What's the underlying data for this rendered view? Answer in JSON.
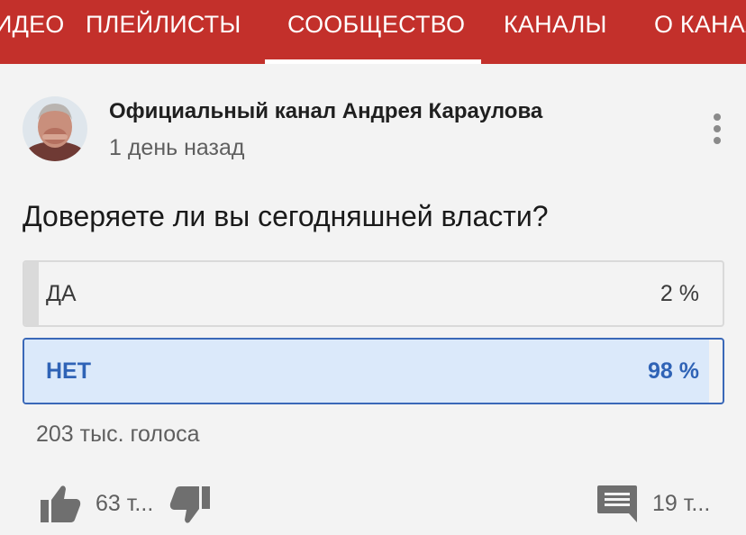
{
  "tabs": [
    {
      "label": "ИДЕО"
    },
    {
      "label": "ПЛЕЙЛИСТЫ"
    },
    {
      "label": "СООБЩЕСТВО",
      "active": true
    },
    {
      "label": "КАНАЛЫ"
    },
    {
      "label": "О КАНАЛЕ"
    }
  ],
  "post": {
    "channel_name": "Официальный канал Андрея Караулова",
    "time": "1 день назад",
    "question": "Доверяете ли вы сегодняшней власти?",
    "options": [
      {
        "label": "ДА",
        "percent_text": "2 %",
        "percent": 2
      },
      {
        "label": "НЕТ",
        "percent_text": "98 %",
        "percent": 98,
        "selected": true
      }
    ],
    "votes": "203 тыс. голоса",
    "likes": "63 т...",
    "comments": "19 т..."
  },
  "icons": {
    "like": "thumbs-up-icon",
    "dislike": "thumbs-down-icon",
    "comment": "comment-icon",
    "more": "more-vert-icon"
  },
  "colors": {
    "header": "#c3302b",
    "selected_accent": "#2f63b6",
    "selected_fill": "#dbe9fa",
    "unselected_fill": "#dadada"
  }
}
